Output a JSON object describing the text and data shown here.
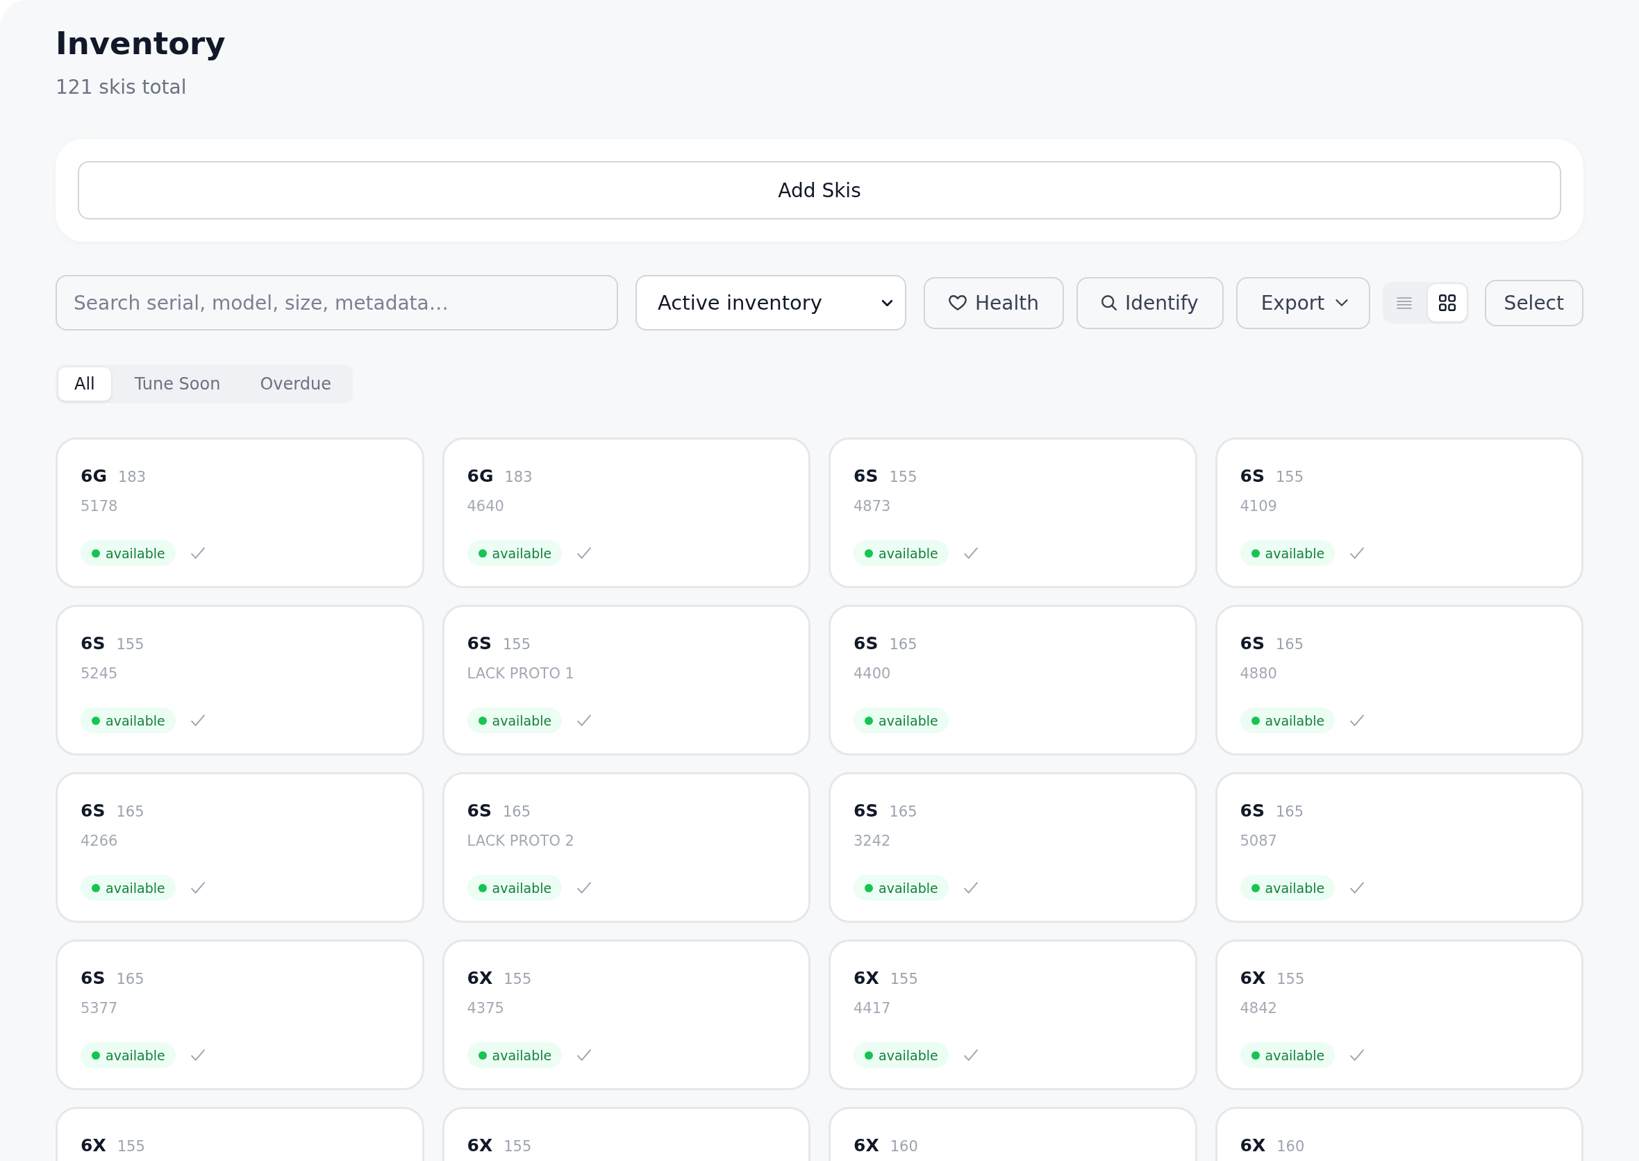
{
  "header": {
    "title": "Inventory",
    "subtitle": "121 skis total"
  },
  "add_button": {
    "label": "Add Skis"
  },
  "toolbar": {
    "search": {
      "placeholder": "Search serial, model, size, metadata…"
    },
    "inventory_select": {
      "value": "Active inventory"
    },
    "buttons": [
      {
        "label": "Health",
        "kind": "heart"
      },
      {
        "label": "Identify",
        "kind": "search"
      },
      {
        "label": "Export",
        "kind": "dropdown"
      }
    ],
    "view_toggle": [
      {
        "kind": "list",
        "selected": false
      },
      {
        "kind": "grid",
        "selected": true
      }
    ],
    "select_button": {
      "label": "Select"
    }
  },
  "filter_tabs": [
    {
      "label": "All",
      "selected": true
    },
    {
      "label": "Tune Soon",
      "selected": false
    },
    {
      "label": "Overdue",
      "selected": false
    }
  ],
  "cards": [
    {
      "model": "6G",
      "size": "183",
      "serial": "5178",
      "status": "available",
      "checkmark": true
    },
    {
      "model": "6G",
      "size": "183",
      "serial": "4640",
      "status": "available",
      "checkmark": true
    },
    {
      "model": "6S",
      "size": "155",
      "serial": "4873",
      "status": "available",
      "checkmark": true
    },
    {
      "model": "6S",
      "size": "155",
      "serial": "4109",
      "status": "available",
      "checkmark": true
    },
    {
      "model": "6S",
      "size": "155",
      "serial": "5245",
      "status": "available",
      "checkmark": true
    },
    {
      "model": "6S",
      "size": "155",
      "serial": "LACK PROTO 1",
      "status": "available",
      "checkmark": true
    },
    {
      "model": "6S",
      "size": "165",
      "serial": "4400",
      "status": "available",
      "checkmark": false
    },
    {
      "model": "6S",
      "size": "165",
      "serial": "4880",
      "status": "available",
      "checkmark": true
    },
    {
      "model": "6S",
      "size": "165",
      "serial": "4266",
      "status": "available",
      "checkmark": true
    },
    {
      "model": "6S",
      "size": "165",
      "serial": "LACK PROTO 2",
      "status": "available",
      "checkmark": true
    },
    {
      "model": "6S",
      "size": "165",
      "serial": "3242",
      "status": "available",
      "checkmark": true
    },
    {
      "model": "6S",
      "size": "165",
      "serial": "5087",
      "status": "available",
      "checkmark": true
    },
    {
      "model": "6S",
      "size": "165",
      "serial": "5377",
      "status": "available",
      "checkmark": true
    },
    {
      "model": "6X",
      "size": "155",
      "serial": "4375",
      "status": "available",
      "checkmark": true
    },
    {
      "model": "6X",
      "size": "155",
      "serial": "4417",
      "status": "available",
      "checkmark": true
    },
    {
      "model": "6X",
      "size": "155",
      "serial": "4842",
      "status": "available",
      "checkmark": true
    },
    {
      "model": "6X",
      "size": "155"
    },
    {
      "model": "6X",
      "size": "155"
    },
    {
      "model": "6X",
      "size": "160"
    },
    {
      "model": "6X",
      "size": "160"
    }
  ]
}
